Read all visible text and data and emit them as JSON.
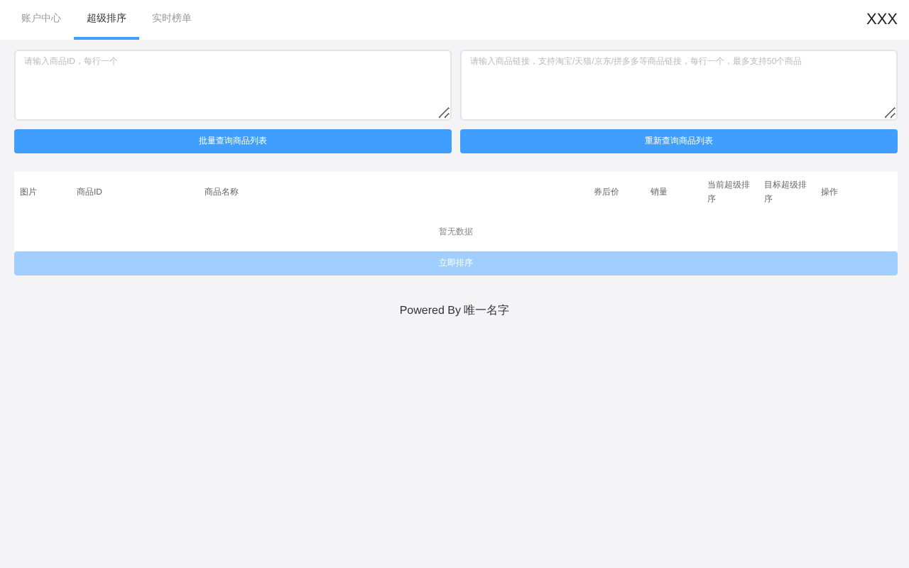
{
  "tabs": [
    {
      "label": "账户中心",
      "selected": false
    },
    {
      "label": "超级排序",
      "selected": true
    },
    {
      "label": "实时榜单",
      "selected": false
    }
  ],
  "user": "XXX",
  "inputs": [
    {
      "placeholder": "请输入商品ID，每行一个",
      "button": "批量查询商品列表"
    },
    {
      "placeholder": "请输入商品链接，支持淘宝/天猫/京东/拼多多等商品链接，每行一个，最多支持50个商品",
      "button": "重新查询商品列表"
    }
  ],
  "table": {
    "columns": [
      "图片",
      "商品ID",
      "商品名称",
      "券后价",
      "销量",
      "当前超级排序",
      "目标超级排序",
      "操作"
    ],
    "empty": "暂无数据"
  },
  "submit": {
    "label": "立即排序",
    "disabled": true
  },
  "footer": "Powered By 唯一名字"
}
